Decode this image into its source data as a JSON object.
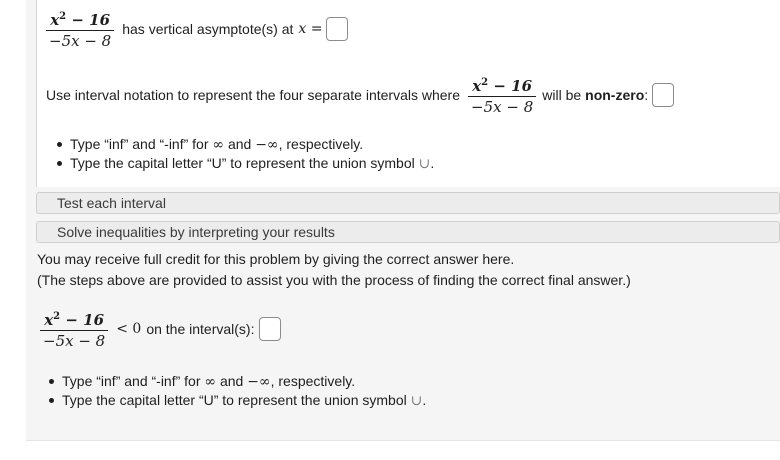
{
  "asymptote": {
    "fraction_num": "x",
    "fraction_num_exp": "2",
    "fraction_num_rest": " − 16",
    "fraction_den": "−5x − 8",
    "text": "has vertical asymptote(s) at",
    "var_eq": "x ="
  },
  "intervals_prompt": {
    "text_before": "Use interval notation to represent the four separate intervals where",
    "text_after": "will be",
    "bold_word": "non-zero",
    "colon": ":"
  },
  "hints_top": [
    {
      "a": "Type “inf” and “-inf” for ",
      "s1": "∞",
      "b": " and ",
      "s2": "−∞",
      "c": ", respectively."
    },
    {
      "a": "Type the capital letter “U” to represent the union symbol ",
      "s1": "∪",
      "b": ".",
      "s2": "",
      "c": ""
    }
  ],
  "sections": {
    "test_each": "Test each interval",
    "solve_ineq": "Solve inequalities by interpreting your results"
  },
  "credit": {
    "line1": "You may receive full credit for this problem by giving the correct answer here.",
    "line2": "(The steps above are provided to assist you with the process of finding the correct final answer.)"
  },
  "final": {
    "ineq": "< 0",
    "text": "on the interval(s):"
  },
  "hints_bottom": [
    {
      "a": "Type “inf” and “-inf” for ",
      "s1": "∞",
      "b": " and ",
      "s2": "−∞",
      "c": ", respectively."
    },
    {
      "a": "Type the capital letter “U” to represent the union symbol ",
      "s1": "∪",
      "b": ".",
      "s2": "",
      "c": ""
    }
  ]
}
